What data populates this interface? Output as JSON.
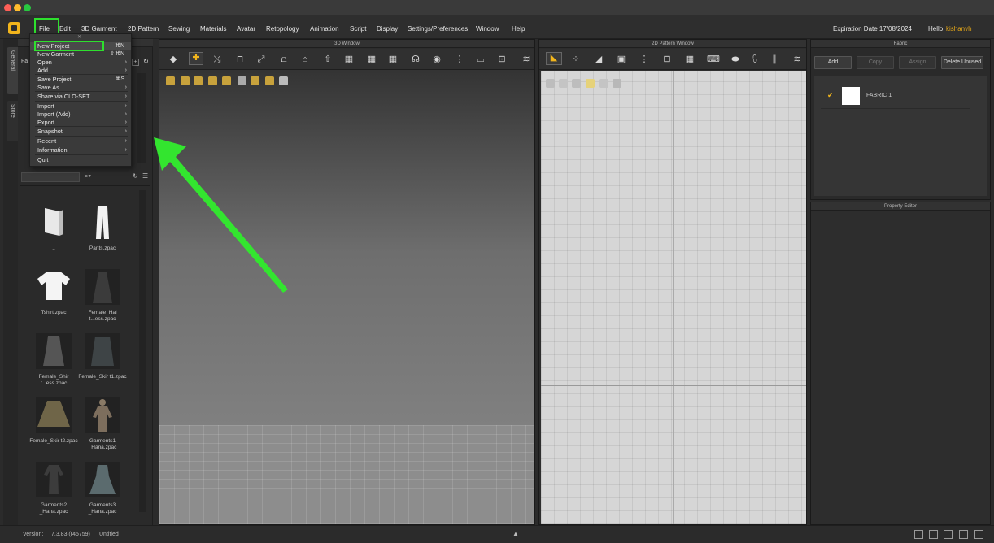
{
  "menubar": {
    "items": [
      "File",
      "Edit",
      "3D Garment",
      "2D Pattern",
      "Sewing",
      "Materials",
      "Avatar",
      "Retopology",
      "Animation",
      "Script",
      "Display",
      "Settings/Preferences",
      "Window",
      "Help"
    ],
    "expiration": "Expiration Date 17/08/2024",
    "hello": "Hello,",
    "username": "kishanvh"
  },
  "left_tabs": [
    "General",
    "Store"
  ],
  "library": {
    "tab_fragment": "Fa",
    "items": [
      {
        "label": ".."
      },
      {
        "label": "Pants.zpac"
      },
      {
        "label": "Tshirt.zpac"
      },
      {
        "label": "Female_Hal t...ess.zpac"
      },
      {
        "label": "Female_Shir r...ess.zpac"
      },
      {
        "label": "Female_Skir t1.zpac"
      },
      {
        "label": "Female_Skir t2.zpac"
      },
      {
        "label": "Garments1 _Hana.zpac"
      },
      {
        "label": "Garments2 _Hana.zpac"
      },
      {
        "label": "Garments3 _Hana.zpac"
      }
    ]
  },
  "file_menu": {
    "items": [
      {
        "label": "New Project",
        "shortcut": "⌘N",
        "submenu": false,
        "highlighted": true
      },
      {
        "label": "New Garment",
        "shortcut": "⇧⌘N",
        "submenu": false
      },
      {
        "label": "Open",
        "shortcut": "",
        "submenu": true
      },
      {
        "label": "Add",
        "shortcut": "",
        "submenu": true
      },
      {
        "label": "Save Project",
        "shortcut": "⌘S",
        "submenu": false
      },
      {
        "label": "Save As",
        "shortcut": "",
        "submenu": true
      },
      {
        "label": "Share via CLO-SET",
        "shortcut": "",
        "submenu": true
      },
      {
        "label": "Import",
        "shortcut": "",
        "submenu": true
      },
      {
        "label": "Import (Add)",
        "shortcut": "",
        "submenu": true
      },
      {
        "label": "Export",
        "shortcut": "",
        "submenu": true
      },
      {
        "label": "Snapshot",
        "shortcut": "",
        "submenu": true
      },
      {
        "label": "Recent",
        "shortcut": "",
        "submenu": true
      },
      {
        "label": "Information",
        "shortcut": "",
        "submenu": true
      },
      {
        "label": "Quit",
        "shortcut": "",
        "submenu": false
      }
    ]
  },
  "windows": {
    "win3d_title": "3D Window",
    "win2d_title": "2D Pattern Window"
  },
  "fabric": {
    "title": "Fabric",
    "buttons": {
      "add": "Add",
      "copy": "Copy",
      "assign": "Assign",
      "delete_unused": "Delete Unused"
    },
    "items": [
      {
        "name": "FABRIC 1",
        "color": "#ffffff"
      }
    ]
  },
  "property_editor": {
    "title": "Property Editor"
  },
  "status": {
    "version_label": "Version:",
    "version": "7.3.83 (r45759)",
    "file": "Untitled"
  },
  "colors": {
    "accent": "#f2b51c",
    "highlight": "#2ee02e",
    "username": "#e6a817"
  },
  "icons": [
    "apple-close",
    "clo-logo",
    "search-icon",
    "refresh-icon",
    "list-view-icon",
    "expand-icon",
    "arrow-annotation"
  ]
}
